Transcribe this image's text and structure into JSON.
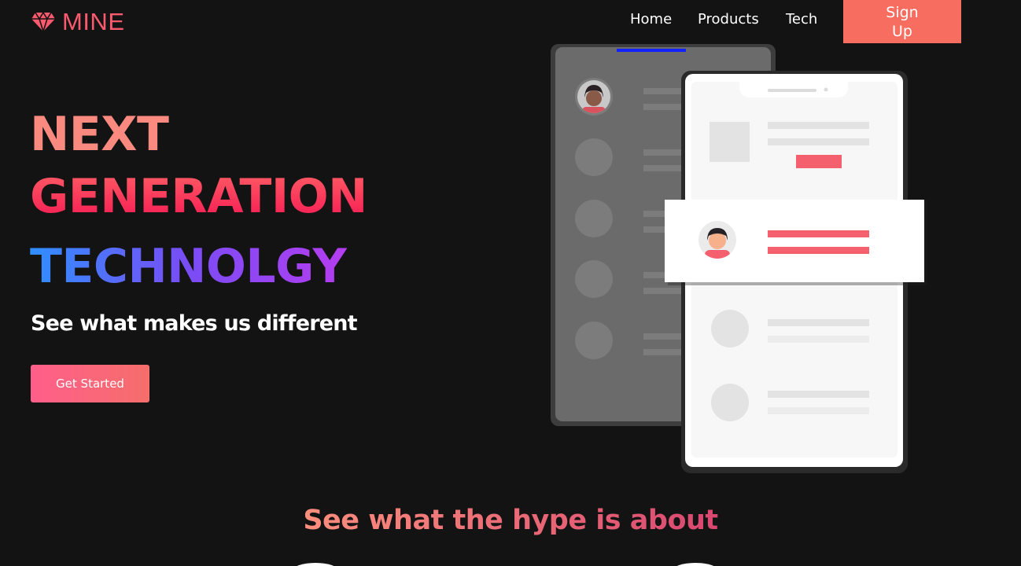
{
  "nav": {
    "brand": "MINE",
    "brand_icon": "diamond-icon",
    "links": [
      "Home",
      "Products",
      "Tech"
    ],
    "signup_label": "Sign Up"
  },
  "hero": {
    "line1": "NEXT",
    "line2": "GENERATION",
    "line3": "TECHNOLGY",
    "subtitle": "See what makes us different",
    "cta_label": "Get Started"
  },
  "section": {
    "heading": "See what the hype is about"
  },
  "colors": {
    "background": "#141314",
    "brand": "#fa5a6d",
    "signup_bg": "#f76d60",
    "accent_red": "#f5606e"
  }
}
